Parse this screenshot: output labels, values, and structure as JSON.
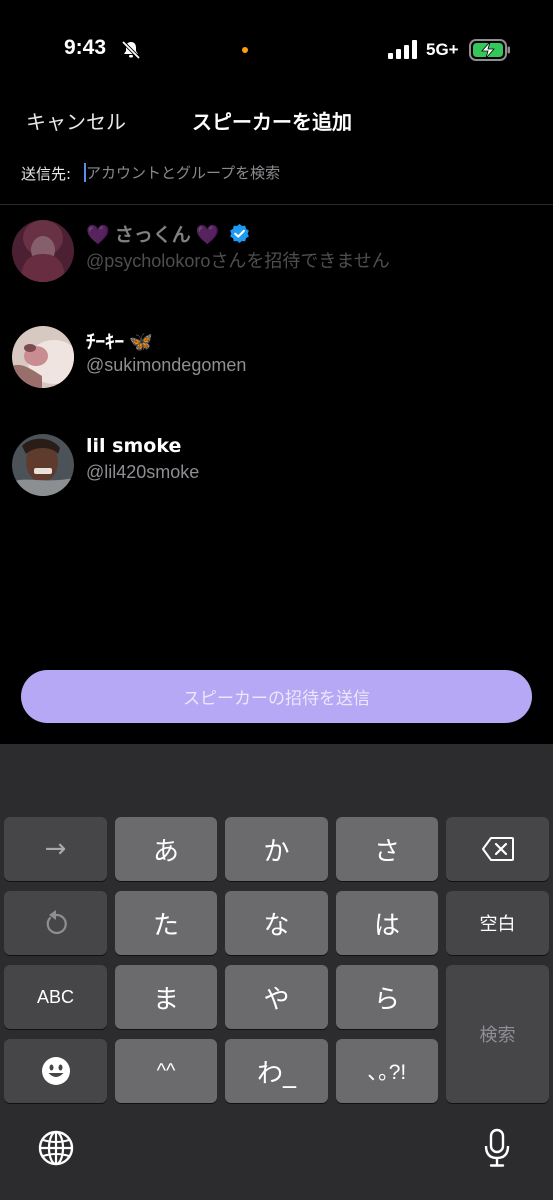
{
  "status_bar": {
    "time": "9:43",
    "network": "5G+"
  },
  "header": {
    "cancel_label": "キャンセル",
    "title": "スピーカーを追加"
  },
  "search": {
    "label": "送信先:",
    "placeholder": "アカウントとグループを検索"
  },
  "users": [
    {
      "name_prefix": "💜",
      "name": "さっくん",
      "name_suffix": "💜",
      "verified": true,
      "handle": "@psycholokoro",
      "note": "さんを招待できません",
      "disabled": true
    },
    {
      "name": "ﾁｰｷｰ",
      "emoji": "🦋",
      "handle": "@sukimondegomen",
      "disabled": false
    },
    {
      "name": "lil smoke",
      "handle": "@lil420smoke",
      "disabled": false
    }
  ],
  "send_button": {
    "label": "スピーカーの招待を送信"
  },
  "keyboard": {
    "rows": {
      "r1": [
        "→",
        "あ",
        "か",
        "さ"
      ],
      "r2": [
        "た",
        "な",
        "は",
        "空白"
      ],
      "r3": [
        "ABC",
        "ま",
        "や",
        "ら",
        "検索"
      ],
      "r4": [
        "^^",
        "わ_",
        "､｡?!"
      ]
    }
  },
  "colors": {
    "accent": "#b6a8f4",
    "verified": "#1d9bf0",
    "battery_green": "#34c759"
  }
}
